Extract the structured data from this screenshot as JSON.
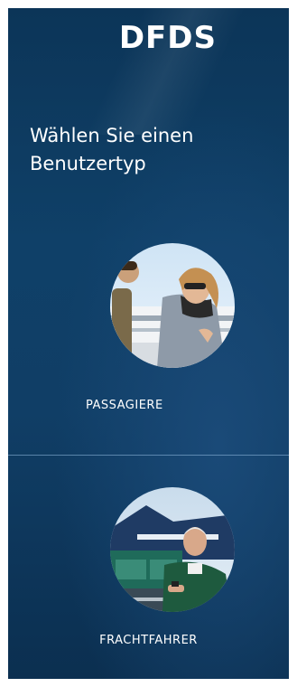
{
  "brand": {
    "logo_text": "DFDS"
  },
  "header": {
    "title": "Wählen Sie einen Benutzertyp"
  },
  "options": [
    {
      "label": "PASSAGIERE"
    },
    {
      "label": "FRACHTFAHRER"
    }
  ],
  "colors": {
    "background": "#0f4068",
    "text": "#ffffff",
    "divider": "#96bee1"
  }
}
